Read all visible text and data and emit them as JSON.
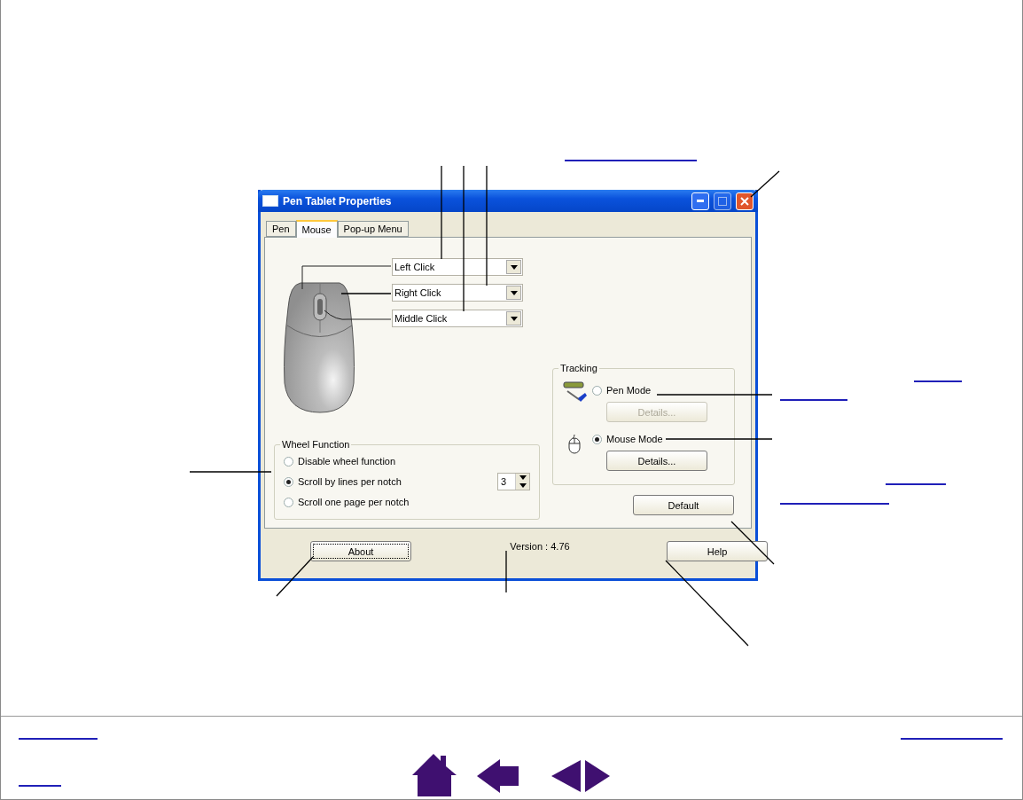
{
  "dialog": {
    "title": "Pen Tablet Properties",
    "tabs": [
      {
        "label": "Pen",
        "selected": false
      },
      {
        "label": "Mouse",
        "selected": true
      },
      {
        "label": "Pop-up Menu",
        "selected": false
      }
    ],
    "button_functions": [
      {
        "value": "Left Click"
      },
      {
        "value": "Right Click"
      },
      {
        "value": "Middle Click"
      }
    ],
    "wheel_function": {
      "title": "Wheel Function",
      "options": [
        {
          "label": "Disable wheel function",
          "selected": false
        },
        {
          "label": "Scroll by lines per notch",
          "selected": true,
          "spinner": "3"
        },
        {
          "label": "Scroll one page per notch",
          "selected": false
        }
      ]
    },
    "tracking": {
      "title": "Tracking",
      "modes": [
        {
          "kind": "pen",
          "label": "Pen Mode",
          "selected": false,
          "details": {
            "label": "Details...",
            "disabled": true
          }
        },
        {
          "kind": "mouse",
          "label": "Mouse Mode",
          "selected": true,
          "details": {
            "label": "Details...",
            "disabled": false
          }
        }
      ]
    },
    "default_button": "Default",
    "about_button": "About",
    "version": "Version : 4.76",
    "help_button": "Help"
  }
}
